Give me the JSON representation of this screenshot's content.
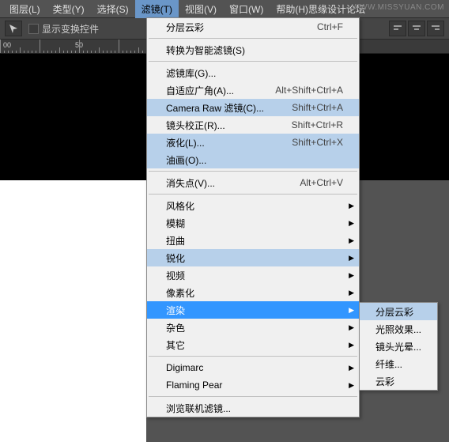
{
  "watermark": "WWW.MISSYUAN.COM",
  "menubar": {
    "items": [
      "图层(L)",
      "类型(Y)",
      "选择(S)",
      "滤镜(T)",
      "视图(V)",
      "窗口(W)",
      "帮助(H)思缘设计论坛"
    ],
    "active_index": 3
  },
  "toolbar": {
    "checkbox_label": "显示变换控件"
  },
  "menu": {
    "groups": [
      [
        {
          "label": "分层云彩",
          "shortcut": "Ctrl+F"
        }
      ],
      [
        {
          "label": "转换为智能滤镜(S)"
        }
      ],
      [
        {
          "label": "滤镜库(G)..."
        },
        {
          "label": "自适应广角(A)...",
          "shortcut": "Alt+Shift+Ctrl+A"
        },
        {
          "label": "Camera Raw 滤镜(C)...",
          "shortcut": "Shift+Ctrl+A",
          "hl": "blue"
        },
        {
          "label": "镜头校正(R)...",
          "shortcut": "Shift+Ctrl+R"
        },
        {
          "label": "液化(L)...",
          "shortcut": "Shift+Ctrl+X",
          "hl": "blue"
        },
        {
          "label": "油画(O)...",
          "hl": "blue"
        }
      ],
      [
        {
          "label": "消失点(V)...",
          "shortcut": "Alt+Ctrl+V"
        }
      ],
      [
        {
          "label": "风格化",
          "submenu": true
        },
        {
          "label": "模糊",
          "submenu": true
        },
        {
          "label": "扭曲",
          "submenu": true
        },
        {
          "label": "锐化",
          "submenu": true,
          "hl": "blue"
        },
        {
          "label": "视频",
          "submenu": true
        },
        {
          "label": "像素化",
          "submenu": true
        },
        {
          "label": "渲染",
          "submenu": true,
          "hl": "sel"
        },
        {
          "label": "杂色",
          "submenu": true
        },
        {
          "label": "其它",
          "submenu": true
        }
      ],
      [
        {
          "label": "Digimarc",
          "submenu": true
        },
        {
          "label": "Flaming Pear",
          "submenu": true
        }
      ],
      [
        {
          "label": "浏览联机滤镜..."
        }
      ]
    ]
  },
  "submenu": {
    "items": [
      {
        "label": "分层云彩",
        "hl": "blue"
      },
      {
        "label": "光照效果..."
      },
      {
        "label": "镜头光晕..."
      },
      {
        "label": "纤维..."
      },
      {
        "label": "云彩"
      }
    ]
  },
  "ruler_numbers": [
    "00",
    "50"
  ]
}
